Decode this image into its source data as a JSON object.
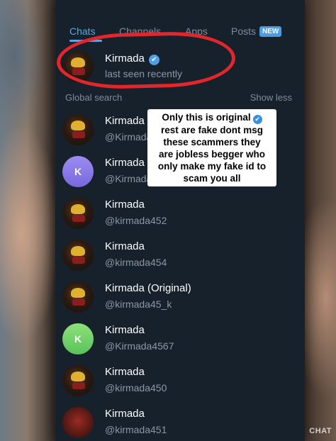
{
  "tabs": [
    {
      "label": "Chats",
      "active": true
    },
    {
      "label": "Channels",
      "active": false
    },
    {
      "label": "Apps",
      "active": false
    },
    {
      "label": "Posts",
      "active": false,
      "badge": "NEW"
    }
  ],
  "top_result": {
    "name": "Kirmada",
    "status": "last seen recently",
    "verified": true
  },
  "global_search": {
    "label": "Global search",
    "toggle": "Show less"
  },
  "annotation": {
    "text": "Only this is original rest are fake dont msg these scammers they are jobless begger who only make my fake id to scam you  all",
    "line1": "Only this is original",
    "lines": [
      "rest are fake dont msg",
      "these scammers they",
      "are jobless begger who",
      "only make my fake id to",
      "scam you  all"
    ]
  },
  "results": [
    {
      "name": "Kirmada",
      "username": "@Kirmada",
      "avatar": "dark-icon"
    },
    {
      "name": "Kirmada",
      "username": "@Kirmada456",
      "avatar": "letter",
      "letter": "K",
      "color": "#8a7ae8"
    },
    {
      "name": "Kirmada",
      "username": "@kirmada452",
      "avatar": "dark-icon"
    },
    {
      "name": "Kirmada",
      "username": "@kirmada454",
      "avatar": "dark-icon"
    },
    {
      "name": "Kirmada (Original)",
      "username": "@kirmada45_k",
      "avatar": "dark-icon"
    },
    {
      "name": "Kirmada",
      "username": "@Kirmada4567",
      "avatar": "letter",
      "letter": "K",
      "color": "#6ccf64"
    },
    {
      "name": "Kirmada",
      "username": "@kirmada450",
      "avatar": "dark-icon"
    },
    {
      "name": "Kirmada",
      "username": "@kirmada451",
      "avatar": "red-icon"
    }
  ],
  "watermark": "CHAT",
  "colors": {
    "accent": "#5ea6e3",
    "background": "#17212b",
    "highlight": "#e3262b"
  }
}
